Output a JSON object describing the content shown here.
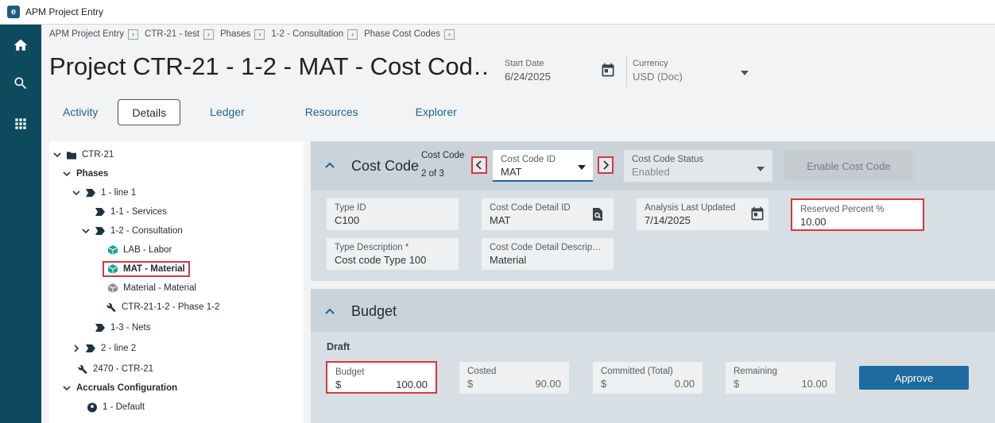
{
  "window": {
    "title": "APM Project Entry"
  },
  "breadcrumb": [
    "APM Project Entry",
    "CTR-21 - test",
    "Phases",
    "1-2 - Consultation",
    "Phase Cost Codes"
  ],
  "page": {
    "title": "Project CTR-21 - 1-2 - MAT - Cost Cod…",
    "start_date_label": "Start Date",
    "start_date": "6/24/2025",
    "currency_label": "Currency",
    "currency": "USD (Doc)"
  },
  "tabs": [
    "Activity",
    "Details",
    "Ledger",
    "Resources",
    "Explorer"
  ],
  "active_tab": "Details",
  "tree": {
    "nodes": [
      {
        "label": "CTR-21"
      },
      {
        "label": "Phases"
      },
      {
        "label": "1 - line 1"
      },
      {
        "label": "1-1 - Services"
      },
      {
        "label": "1-2 - Consultation"
      },
      {
        "label": "LAB - Labor"
      },
      {
        "label": "MAT - Material"
      },
      {
        "label": "Material - Material"
      },
      {
        "label": "CTR-21-1-2 - Phase 1-2"
      },
      {
        "label": "1-3 - Nets"
      },
      {
        "label": "2 - line 2"
      },
      {
        "label": "2470 - CTR-21"
      },
      {
        "label": "Accruals Configuration"
      },
      {
        "label": "1 - Default"
      }
    ]
  },
  "cost_code": {
    "section_title": "Cost Code",
    "counter_label": "Cost Code",
    "counter": "2 of 3",
    "id_label": "Cost Code ID",
    "id_value": "MAT",
    "status_label": "Cost Code Status",
    "status_value": "Enabled",
    "enable_button": "Enable Cost Code",
    "type_id_label": "Type ID",
    "type_id": "C100",
    "detail_id_label": "Cost Code Detail ID",
    "detail_id": "MAT",
    "analysis_label": "Analysis Last Updated",
    "analysis_value": "7/14/2025",
    "reserved_label": "Reserved Percent %",
    "reserved_value": "10.00",
    "type_desc_label": "Type Description *",
    "type_desc": "Cost code Type 100",
    "detail_desc_label": "Cost Code Detail Descrip…",
    "detail_desc": "Material"
  },
  "budget": {
    "section_title": "Budget",
    "draft_label": "Draft",
    "currency_symbol": "$",
    "budget_label": "Budget",
    "budget_value": "100.00",
    "costed_label": "Costed",
    "costed_value": "90.00",
    "committed_label": "Committed (Total)",
    "committed_value": "0.00",
    "remaining_label": "Remaining",
    "remaining_value": "10.00",
    "approve_button": "Approve"
  },
  "colors": {
    "rail": "#0e4a5e",
    "primary": "#1f6ba0",
    "highlight": "#d9363e",
    "panel": "#d7dfe4",
    "teal_icon": "#17a69a"
  }
}
